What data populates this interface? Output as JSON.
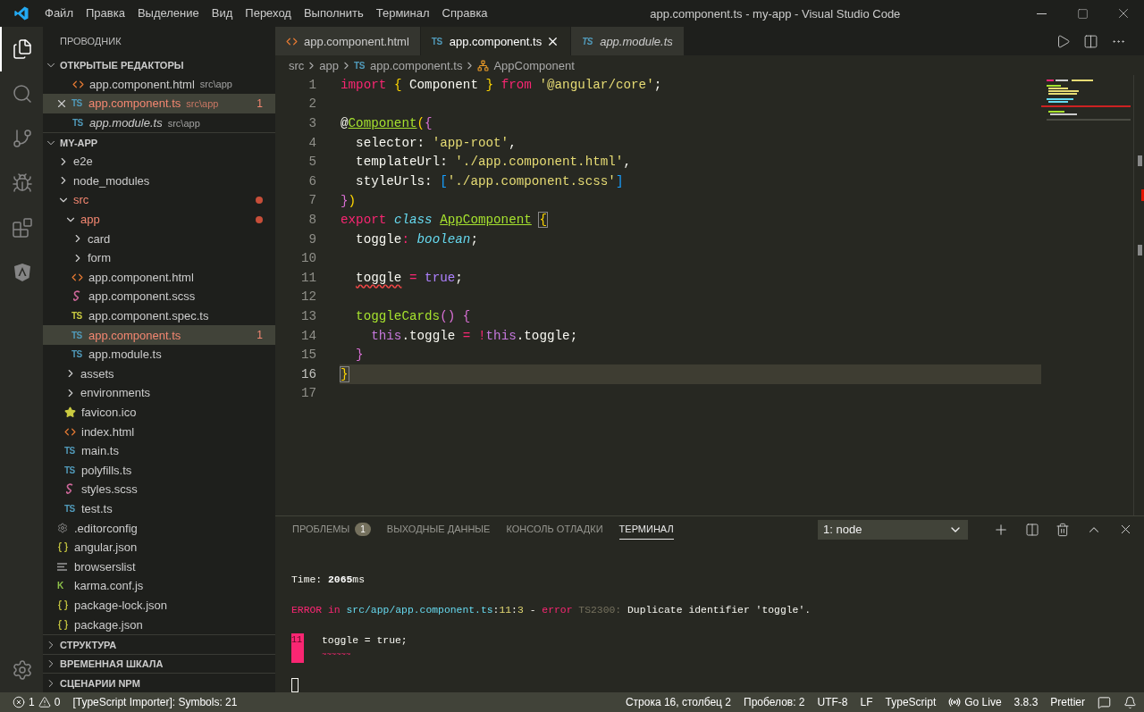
{
  "window": {
    "title": "app.component.ts - my-app - Visual Studio Code"
  },
  "menu": [
    "Файл",
    "Правка",
    "Выделение",
    "Вид",
    "Переход",
    "Выполнить",
    "Терминал",
    "Справка"
  ],
  "activity_bar": [
    {
      "kind": "files",
      "selected": true
    },
    {
      "kind": "search",
      "selected": false
    },
    {
      "kind": "git",
      "selected": false
    },
    {
      "kind": "debug",
      "selected": false
    },
    {
      "kind": "extensions",
      "selected": false
    },
    {
      "kind": "angular",
      "selected": false
    }
  ],
  "explorer": {
    "title": "ПРОВОДНИК",
    "open_editors": {
      "title": "ОТКРЫТЫЕ РЕДАКТОРЫ",
      "expanded": true,
      "items": [
        {
          "name": "app.component.html",
          "path": "src\\app",
          "kind": "html",
          "selected": false,
          "preview": false,
          "error": false
        },
        {
          "name": "app.component.ts",
          "path": "src\\app",
          "kind": "ts",
          "icon_label": "TS",
          "selected": true,
          "preview": false,
          "error": true,
          "badge": "1"
        },
        {
          "name": "app.module.ts",
          "path": "src\\app",
          "kind": "ts",
          "icon_label": "TS",
          "selected": false,
          "preview": true,
          "error": false
        }
      ]
    },
    "project": {
      "title": "MY-APP",
      "expanded": true,
      "items": [
        {
          "kind": "folder",
          "name": "e2e",
          "expanded": false,
          "selected": false,
          "error": false
        },
        {
          "kind": "folder",
          "name": "node_modules",
          "expanded": false,
          "selected": false,
          "error": false
        },
        {
          "kind": "folder",
          "name": "src",
          "expanded": true,
          "selected": false,
          "error": true,
          "children": [
            {
              "kind": "folder",
              "name": "app",
              "expanded": true,
              "selected": false,
              "error": true,
              "children": [
                {
                  "kind": "folder",
                  "name": "card",
                  "expanded": false,
                  "selected": false,
                  "error": false
                },
                {
                  "kind": "folder",
                  "name": "form",
                  "expanded": false,
                  "selected": false,
                  "error": false
                },
                {
                  "kind": "html",
                  "name": "app.component.html",
                  "selected": false,
                  "error": false
                },
                {
                  "kind": "scss",
                  "name": "app.component.scss",
                  "selected": false,
                  "error": false
                },
                {
                  "kind": "tsspec",
                  "name": "app.component.spec.ts",
                  "icon_label": "TS",
                  "selected": false,
                  "error": false
                },
                {
                  "kind": "ts",
                  "name": "app.component.ts",
                  "icon_label": "TS",
                  "selected": true,
                  "error": true,
                  "badge": "1"
                },
                {
                  "kind": "ts",
                  "name": "app.module.ts",
                  "icon_label": "TS",
                  "selected": false,
                  "error": false
                }
              ]
            },
            {
              "kind": "folder",
              "name": "assets",
              "expanded": false,
              "selected": false,
              "error": false
            },
            {
              "kind": "folder",
              "name": "environments",
              "expanded": false,
              "selected": false,
              "error": false
            },
            {
              "kind": "star",
              "name": "favicon.ico",
              "selected": false,
              "error": false
            },
            {
              "kind": "html",
              "name": "index.html",
              "selected": false,
              "error": false
            },
            {
              "kind": "ts",
              "name": "main.ts",
              "icon_label": "TS",
              "selected": false,
              "error": false
            },
            {
              "kind": "ts",
              "name": "polyfills.ts",
              "icon_label": "TS",
              "selected": false,
              "error": false
            },
            {
              "kind": "scss",
              "name": "styles.scss",
              "selected": false,
              "error": false
            },
            {
              "kind": "ts",
              "name": "test.ts",
              "icon_label": "TS",
              "selected": false,
              "error": false
            }
          ]
        },
        {
          "kind": "gear",
          "name": ".editorconfig",
          "selected": false,
          "error": false
        },
        {
          "kind": "json",
          "name": "angular.json",
          "selected": false,
          "error": false
        },
        {
          "kind": "lines",
          "name": "browserslist",
          "selected": false,
          "error": false
        },
        {
          "kind": "letter",
          "name": "karma.conf.js",
          "icon_label": "K",
          "selected": false,
          "error": false
        },
        {
          "kind": "json",
          "name": "package-lock.json",
          "selected": false,
          "error": false
        },
        {
          "kind": "json",
          "name": "package.json",
          "selected": false,
          "error": false
        }
      ]
    },
    "sections": [
      {
        "title": "СТРУКТУРА",
        "expanded": false
      },
      {
        "title": "ВРЕМЕННАЯ ШКАЛА",
        "expanded": false
      },
      {
        "title": "СЦЕНАРИИ NPM",
        "expanded": false
      }
    ]
  },
  "tabs": [
    {
      "label": "app.component.html",
      "kind": "html",
      "selected": false,
      "preview": false
    },
    {
      "label": "app.component.ts",
      "kind": "ts",
      "icon_label": "TS",
      "selected": true,
      "preview": false
    },
    {
      "label": "app.module.ts",
      "kind": "ts",
      "icon_label": "TS",
      "selected": false,
      "preview": true
    }
  ],
  "breadcrumbs": [
    {
      "text": "src",
      "kind": "folder"
    },
    {
      "text": "app",
      "kind": "folder"
    },
    {
      "text": "app.component.ts",
      "kind": "ts",
      "icon_label": "TS"
    },
    {
      "text": "AppComponent",
      "kind": "class"
    }
  ],
  "code": {
    "lines": [
      {
        "number": "1",
        "current": false,
        "tokens": [
          {
            "text": "import",
            "kind": "kw"
          },
          {
            "text": " {",
            "kind": "b1"
          },
          {
            "text": " Component ",
            "kind": "plain"
          },
          {
            "text": "}",
            "kind": "b1"
          },
          {
            "text": " from",
            "kind": "kw"
          },
          {
            "text": " '@angular/core'",
            "kind": "str"
          },
          {
            "text": ";",
            "kind": "plain"
          }
        ]
      },
      {
        "number": "2",
        "current": false
      },
      {
        "number": "3",
        "current": false,
        "tokens": [
          {
            "text": "@",
            "kind": "plain"
          },
          {
            "text": "Component",
            "kind": "cls"
          },
          {
            "text": "(",
            "kind": "b1"
          },
          {
            "text": "{",
            "kind": "b2"
          }
        ]
      },
      {
        "number": "4",
        "current": false,
        "tokens": [
          {
            "text": "  selector: ",
            "kind": "plain"
          },
          {
            "text": "'app-root'",
            "kind": "str"
          },
          {
            "text": ",",
            "kind": "plain"
          }
        ]
      },
      {
        "number": "5",
        "current": false,
        "tokens": [
          {
            "text": "  templateUrl: ",
            "kind": "plain"
          },
          {
            "text": "'./app.component.html'",
            "kind": "str"
          },
          {
            "text": ",",
            "kind": "plain"
          }
        ]
      },
      {
        "number": "6",
        "current": false,
        "tokens": [
          {
            "text": "  styleUrls: ",
            "kind": "plain"
          },
          {
            "text": "[",
            "kind": "b3"
          },
          {
            "text": "'./app.component.scss'",
            "kind": "str"
          },
          {
            "text": "]",
            "kind": "b3"
          }
        ]
      },
      {
        "number": "7",
        "current": false,
        "tokens": [
          {
            "text": "}",
            "kind": "b2"
          },
          {
            "text": ")",
            "kind": "b1"
          }
        ]
      },
      {
        "number": "8",
        "current": false,
        "tokens": [
          {
            "text": "export",
            "kind": "kw"
          },
          {
            "text": " class",
            "kind": "type"
          },
          {
            "text": " AppComponent",
            "kind": "cls"
          },
          {
            "text": " {",
            "kind": "b1m"
          }
        ]
      },
      {
        "number": "9",
        "current": false,
        "tokens": [
          {
            "text": "  toggle",
            "kind": "plain"
          },
          {
            "text": ":",
            "kind": "kw"
          },
          {
            "text": " boolean",
            "kind": "type"
          },
          {
            "text": ";",
            "kind": "plain"
          }
        ]
      },
      {
        "number": "10",
        "current": false
      },
      {
        "number": "11",
        "current": false,
        "tokens": [
          {
            "text": "  toggle",
            "kind": "err"
          },
          {
            "text": " =",
            "kind": "kw"
          },
          {
            "text": " true",
            "kind": "const"
          },
          {
            "text": ";",
            "kind": "plain"
          }
        ]
      },
      {
        "number": "12",
        "current": false
      },
      {
        "number": "13",
        "current": false,
        "tokens": [
          {
            "text": "  toggleCards",
            "kind": "fn"
          },
          {
            "text": "()",
            "kind": "b2"
          },
          {
            "text": " {",
            "kind": "b2"
          }
        ]
      },
      {
        "number": "14",
        "current": false,
        "tokens": [
          {
            "text": "    this",
            "kind": "this"
          },
          {
            "text": ".toggle ",
            "kind": "plain"
          },
          {
            "text": "=",
            "kind": "kw"
          },
          {
            "text": " !",
            "kind": "kw"
          },
          {
            "text": "this",
            "kind": "this"
          },
          {
            "text": ".toggle;",
            "kind": "plain"
          }
        ]
      },
      {
        "number": "15",
        "current": false,
        "tokens": [
          {
            "text": "  }",
            "kind": "b2"
          }
        ]
      },
      {
        "number": "16",
        "current": true,
        "tokens": [
          {
            "text": "}",
            "kind": "b1m"
          }
        ]
      },
      {
        "number": "17",
        "current": false
      }
    ]
  },
  "panel": {
    "tabs": [
      {
        "label": "ПРОБЛЕМЫ",
        "badge": "1",
        "selected": false
      },
      {
        "label": "ВЫХОДНЫЕ ДАННЫЕ",
        "selected": false
      },
      {
        "label": "КОНСОЛЬ ОТЛАДКИ",
        "selected": false
      },
      {
        "label": "ТЕРМИНАЛ",
        "selected": true
      }
    ],
    "terminal_select": "1: node",
    "terminal": [
      {
        "kind": "text",
        "segments": [
          {
            "text": "Time: ",
            "kind": "plain"
          },
          {
            "text": "2065",
            "kind": "bold"
          },
          {
            "text": "ms",
            "kind": "plain"
          }
        ]
      },
      {
        "kind": "text",
        "segments": [
          {
            "text": "ERROR in ",
            "kind": "err"
          },
          {
            "text": "src/app/app.component.ts",
            "kind": "path"
          },
          {
            "text": ":",
            "kind": "plain"
          },
          {
            "text": "11",
            "kind": "num"
          },
          {
            "text": ":",
            "kind": "plain"
          },
          {
            "text": "3",
            "kind": "num"
          },
          {
            "text": " - ",
            "kind": "plain"
          },
          {
            "text": "error",
            "kind": "err"
          },
          {
            "text": " TS2300:",
            "kind": "dim"
          },
          {
            "text": " Duplicate identifier 'toggle'.",
            "kind": "plain"
          }
        ]
      },
      {
        "kind": "source",
        "gutter": "11",
        "text": "toggle = true;",
        "squiggle": "~~~~~~"
      },
      {
        "kind": "cursor"
      }
    ]
  },
  "status_bar": {
    "errors": "1",
    "warnings": "0",
    "left_text": "[TypeScript Importer]: Symbols: 21",
    "right": [
      {
        "text": "Строка 16, столбец 2",
        "kind": "text"
      },
      {
        "text": "Пробелов: 2",
        "kind": "text"
      },
      {
        "text": "UTF-8",
        "kind": "text"
      },
      {
        "text": "LF",
        "kind": "text"
      },
      {
        "text": "TypeScript",
        "kind": "text"
      },
      {
        "text": "Go Live",
        "kind": "broadcast"
      },
      {
        "text": "3.8.3",
        "kind": "text"
      },
      {
        "text": "Prettier",
        "kind": "text"
      }
    ]
  }
}
